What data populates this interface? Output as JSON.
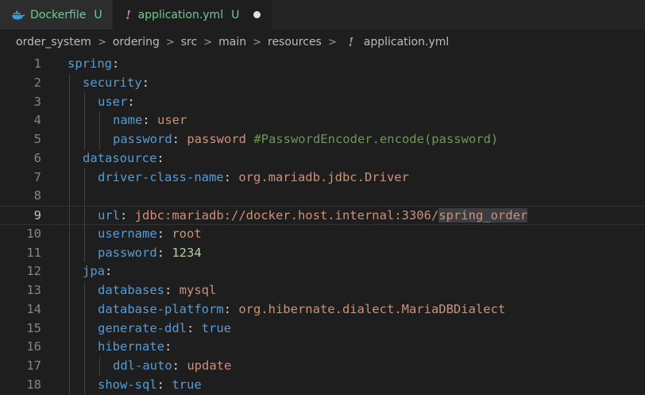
{
  "tabs": [
    {
      "name": "Dockerfile",
      "badge": "U",
      "icon": "docker-icon"
    },
    {
      "name": "application.yml",
      "badge": "U",
      "icon": "yaml-icon",
      "active": true,
      "modified": true
    }
  ],
  "breadcrumb": [
    "order_system",
    "ordering",
    "src",
    "main",
    "resources",
    "application.yml"
  ],
  "code": {
    "lines": [
      {
        "num": "1",
        "indent": 0,
        "key": "spring",
        "colon": ":",
        "value": ""
      },
      {
        "num": "2",
        "indent": 1,
        "key": "security",
        "colon": ":",
        "value": ""
      },
      {
        "num": "3",
        "indent": 2,
        "key": "user",
        "colon": ":",
        "value": ""
      },
      {
        "num": "4",
        "indent": 3,
        "key": "name",
        "colon": ": ",
        "value": "user"
      },
      {
        "num": "5",
        "indent": 3,
        "key": "password",
        "colon": ": ",
        "value": "password",
        "comment": " #PasswordEncoder.encode(password)"
      },
      {
        "num": "6",
        "indent": 1,
        "key": "datasource",
        "colon": ":",
        "value": ""
      },
      {
        "num": "7",
        "indent": 2,
        "key": "driver-class-name",
        "colon": ": ",
        "value": "org.mariadb.jdbc.Driver"
      },
      {
        "num": "8",
        "indent": 2,
        "key": "",
        "colon": "",
        "value": ""
      },
      {
        "num": "9",
        "indent": 2,
        "key": "url",
        "colon": ": ",
        "value": "jdbc:mariadb://docker.host.internal:3306/",
        "highlight": "spring_order",
        "current": true
      },
      {
        "num": "10",
        "indent": 2,
        "key": "username",
        "colon": ": ",
        "value": "root"
      },
      {
        "num": "11",
        "indent": 2,
        "key": "password",
        "colon": ": ",
        "num_value": "1234"
      },
      {
        "num": "12",
        "indent": 1,
        "key": "jpa",
        "colon": ":",
        "value": ""
      },
      {
        "num": "13",
        "indent": 2,
        "key": "databases",
        "colon": ": ",
        "value": "mysql"
      },
      {
        "num": "14",
        "indent": 2,
        "key": "database-platform",
        "colon": ": ",
        "value": "org.hibernate.dialect.MariaDBDialect"
      },
      {
        "num": "15",
        "indent": 2,
        "key": "generate-ddl",
        "colon": ": ",
        "bool_value": "true"
      },
      {
        "num": "16",
        "indent": 2,
        "key": "hibernate",
        "colon": ":",
        "value": ""
      },
      {
        "num": "17",
        "indent": 3,
        "key": "ddl-auto",
        "colon": ": ",
        "value": "update"
      },
      {
        "num": "18",
        "indent": 2,
        "key": "show-sql",
        "colon": ": ",
        "bool_value": "true"
      }
    ]
  },
  "colors": {
    "key": "#569cd6",
    "string": "#ce9178",
    "number": "#b5cea8",
    "comment": "#6a9955",
    "untracked": "#73c991"
  }
}
